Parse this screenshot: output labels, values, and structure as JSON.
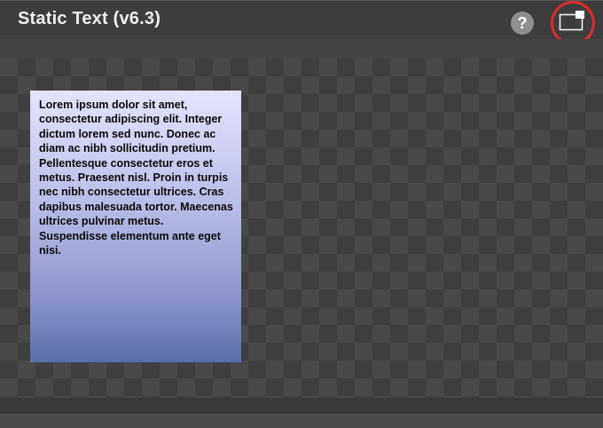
{
  "window": {
    "title": "Static Text (v6.3)"
  },
  "toolbar": {
    "help_label": "?",
    "help_icon": "question-mark-icon",
    "popout_icon": "popout-window-icon",
    "highlight_color": "#e02a2a"
  },
  "content": {
    "static_text": "Lorem ipsum dolor sit amet, consectetur adipiscing elit. Integer dictum lorem sed nunc. Donec ac diam ac nibh sollicitudin pretium. Pellentesque consectetur eros et metus. Praesent nisl. Proin in turpis nec nibh consectetur ultrices. Cras dapibus malesuada tortor. Maecenas ultrices pulvinar metus. Suspendisse elementum ante eget nisi.",
    "gradient_top": "#e4e4ff",
    "gradient_bottom": "#5a6eab"
  }
}
